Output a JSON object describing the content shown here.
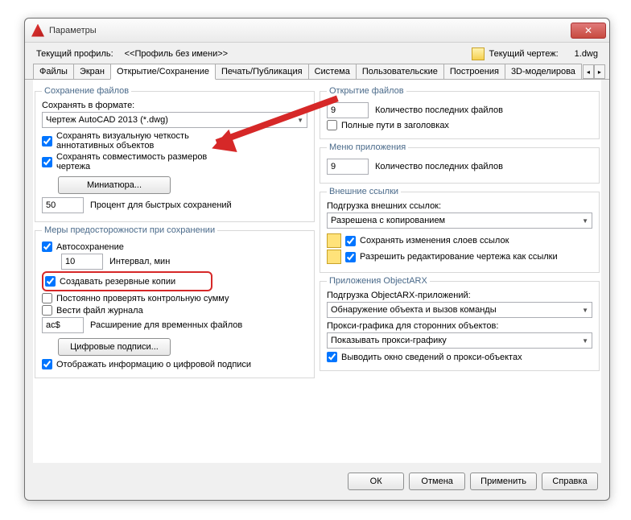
{
  "window": {
    "title": "Параметры"
  },
  "info": {
    "profile_label": "Текущий профиль:",
    "profile_value": "<<Профиль без имени>>",
    "drawing_label": "Текущий чертеж:",
    "drawing_value": "1.dwg"
  },
  "tabs": [
    "Файлы",
    "Экран",
    "Открытие/Сохранение",
    "Печать/Публикация",
    "Система",
    "Пользовательские",
    "Построения",
    "3D-моделирова"
  ],
  "left": {
    "group1": {
      "legend": "Сохранение файлов",
      "format_label": "Сохранять в формате:",
      "format_value": "Чертеж AutoCAD 2013 (*.dwg)",
      "cb_visual": "Сохранять визуальную четкость аннотативных объектов",
      "cb_compat": "Сохранять совместимость размеров чертежа",
      "btn_thumb": "Миниатюра...",
      "pct_value": "50",
      "pct_label": "Процент для быстрых сохранений"
    },
    "group2": {
      "legend": "Меры предосторожности при сохранении",
      "cb_autosave": "Автосохранение",
      "interval_value": "10",
      "interval_label": "Интервал, мин",
      "cb_backup": "Создавать резервные копии",
      "cb_crc": "Постоянно проверять контрольную сумму",
      "cb_log": "Вести файл журнала",
      "ext_value": "ac$",
      "ext_label": "Расширение для временных файлов",
      "btn_sig": "Цифровые подписи...",
      "cb_siginfo": "Отображать информацию о цифровой подписи"
    }
  },
  "right": {
    "group1": {
      "legend": "Открытие файлов",
      "recent_value": "9",
      "recent_label": "Количество последних файлов",
      "cb_fullpath": "Полные пути в заголовках"
    },
    "group2": {
      "legend": "Меню приложения",
      "recent_value": "9",
      "recent_label": "Количество последних файлов"
    },
    "group3": {
      "legend": "Внешние ссылки",
      "load_label": "Подгрузка внешних ссылок:",
      "load_value": "Разрешена с копированием",
      "cb_layers": "Сохранять изменения слоев ссылок",
      "cb_edit": "Разрешить редактирование чертежа как ссылки"
    },
    "group4": {
      "legend": "Приложения ObjectARX",
      "arx_label": "Подгрузка ObjectARX-приложений:",
      "arx_value": "Обнаружение объекта и вызов команды",
      "proxy_label": "Прокси-графика для сторонних объектов:",
      "proxy_value": "Показывать прокси-графику",
      "cb_proxyinfo": "Выводить окно сведений о прокси-объектах"
    }
  },
  "buttons": {
    "ok": "ОК",
    "cancel": "Отмена",
    "apply": "Применить",
    "help": "Справка"
  }
}
